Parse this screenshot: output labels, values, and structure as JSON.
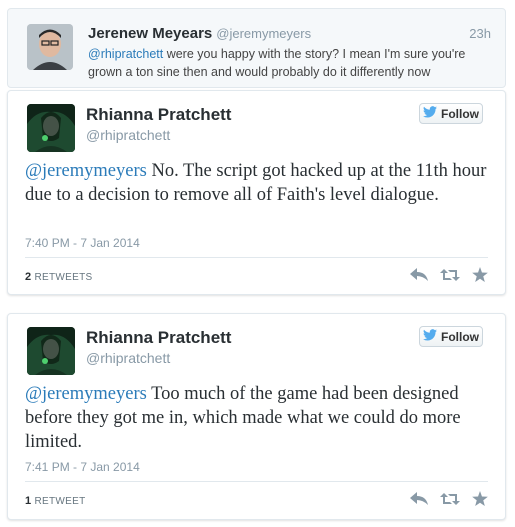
{
  "reply": {
    "name": "Jerenew Meyears",
    "handle": "@jeremymeyers",
    "time": "23h",
    "mention": "@rhipratchett",
    "text": " were you happy with the story? I mean I'm sure you're grown a ton sine then and would probably do it differently now"
  },
  "tweets": [
    {
      "name": "Rhianna Pratchett",
      "handle": "@rhipratchett",
      "follow_label": "Follow",
      "mention": "@jeremymeyers",
      "text": " No. The script got hacked up at the 11th hour due to a decision to remove all of Faith's level dialogue.",
      "timestamp": "7:40 PM - 7 Jan 2014",
      "retweet_count": "2",
      "retweet_label": "RETWEETS"
    },
    {
      "name": "Rhianna Pratchett",
      "handle": "@rhipratchett",
      "follow_label": "Follow",
      "mention": "@jeremymeyers",
      "text": " Too much of the game had been designed before they got me in, which made what we could do more limited.",
      "timestamp": "7:41 PM - 7 Jan 2014",
      "retweet_count": "1",
      "retweet_label": "RETWEET"
    }
  ],
  "colors": {
    "link": "#2b7bb9",
    "bird": "#55acee",
    "muted": "#8899a6"
  },
  "icons": [
    "twitter-bird-icon",
    "reply-icon",
    "retweet-icon",
    "favorite-icon"
  ]
}
